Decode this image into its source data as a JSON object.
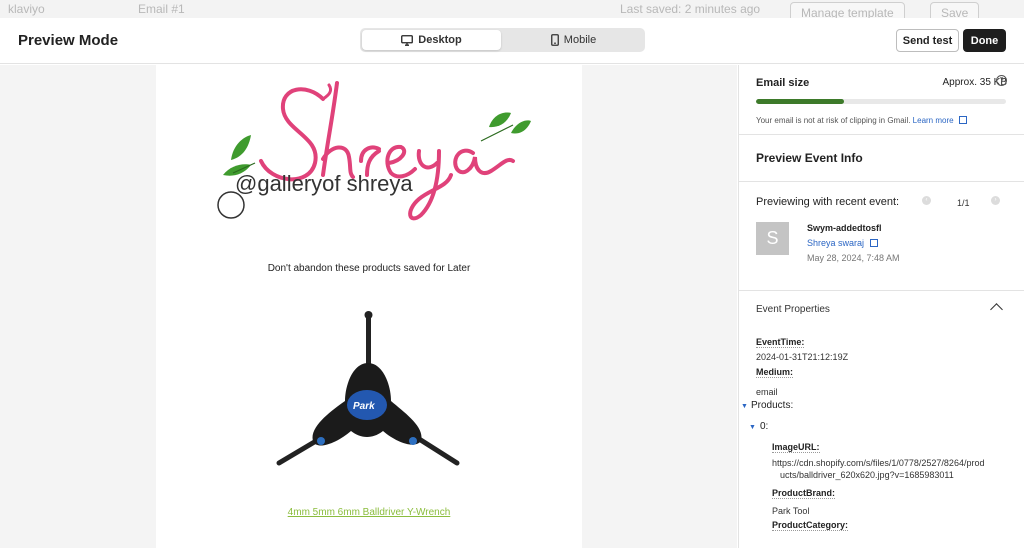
{
  "app_bar": {
    "logo": "klaviyo",
    "email_name": "Email #1",
    "last_saved": "Last saved: 2 minutes ago",
    "manage_template": "Manage template",
    "save": "Save"
  },
  "header": {
    "title": "Preview Mode",
    "tabs": [
      {
        "label": "Desktop",
        "icon": "desktop-icon",
        "active": true
      },
      {
        "label": "Mobile",
        "icon": "mobile-icon",
        "active": false
      }
    ],
    "send_test": "Send test",
    "done": "Done"
  },
  "email": {
    "logo_text_main": "Shreya",
    "logo_text_handle": "@galleryof shreya",
    "subheading": "Don't abandon these products saved for Later",
    "product_image_icon": "y-wrench-image",
    "product_link": "4mm 5mm 6mm Balldriver Y-Wrench"
  },
  "sidebar": {
    "email_size": {
      "label": "Email size",
      "value": "Approx. 35 KB",
      "fraction": 0.35,
      "note": "Your email is not at risk of clipping in Gmail.",
      "learn_more": "Learn more",
      "bar_color": "#3d7a2a"
    },
    "preview_event_info": {
      "title": "Preview Event Info"
    },
    "event": {
      "previewing_label": "Previewing with recent event:",
      "count": "1/1",
      "avatar_letter": "S",
      "name": "Swym-addedtosfl",
      "person": "Shreya swaraj",
      "date": "May 28, 2024, 7:48 AM"
    },
    "properties": {
      "title": "Event Properties",
      "event_time_key": "EventTime:",
      "event_time_value": "2024-01-31T21:12:19Z",
      "medium_key": "Medium:",
      "medium_value": "email",
      "products_key": "Products:",
      "index_key": "0:",
      "image_url_key": "ImageURL:",
      "image_url_value_1": "https://cdn.shopify.com/s/files/1/0778/2527/8264/prod",
      "image_url_value_2": "ucts/balldriver_620x620.jpg?v=1685983011",
      "product_brand_key": "ProductBrand:",
      "product_brand_value": "Park Tool",
      "product_category_key": "ProductCategory:"
    }
  },
  "colors": {
    "link_blue": "#2b66c4",
    "product_link_green": "#8bbd3d",
    "logo_pink": "#e0427a",
    "leaf_green": "#3f9b2e"
  }
}
